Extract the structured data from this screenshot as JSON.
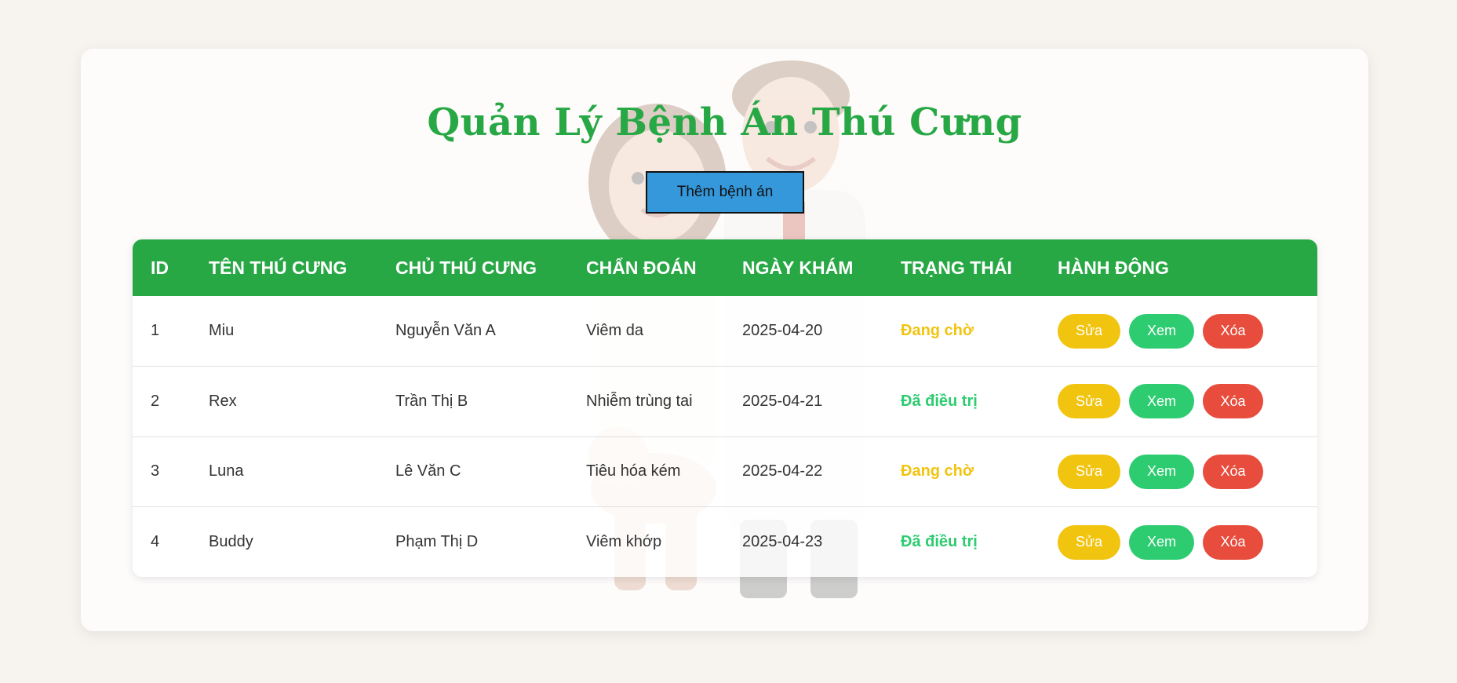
{
  "page": {
    "title": "Quản Lý Bệnh Án Thú Cưng",
    "add_button_label": "Thêm bệnh án"
  },
  "colors": {
    "brand_green": "#28a745",
    "add_button_blue": "#3498db",
    "status_pending": "#f1c40f",
    "status_treated": "#2ecc71",
    "edit": "#f1c40f",
    "view": "#2ecc71",
    "delete": "#e74c3c"
  },
  "table": {
    "headers": [
      "ID",
      "TÊN THÚ CƯNG",
      "CHỦ THÚ CƯNG",
      "CHẨN ĐOÁN",
      "NGÀY KHÁM",
      "TRẠNG THÁI",
      "HÀNH ĐỘNG"
    ],
    "rows": [
      {
        "id": "1",
        "pet": "Miu",
        "owner": "Nguyễn Văn A",
        "diagnosis": "Viêm da",
        "date": "2025-04-20",
        "status": "Đang chờ",
        "status_kind": "pending"
      },
      {
        "id": "2",
        "pet": "Rex",
        "owner": "Trần Thị B",
        "diagnosis": "Nhiễm trùng tai",
        "date": "2025-04-21",
        "status": "Đã điều trị",
        "status_kind": "treated"
      },
      {
        "id": "3",
        "pet": "Luna",
        "owner": "Lê Văn C",
        "diagnosis": "Tiêu hóa kém",
        "date": "2025-04-22",
        "status": "Đang chờ",
        "status_kind": "pending"
      },
      {
        "id": "4",
        "pet": "Buddy",
        "owner": "Phạm Thị D",
        "diagnosis": "Viêm khớp",
        "date": "2025-04-23",
        "status": "Đã điều trị",
        "status_kind": "treated"
      }
    ],
    "actions": {
      "edit_label": "Sửa",
      "view_label": "Xem",
      "delete_label": "Xóa"
    }
  }
}
